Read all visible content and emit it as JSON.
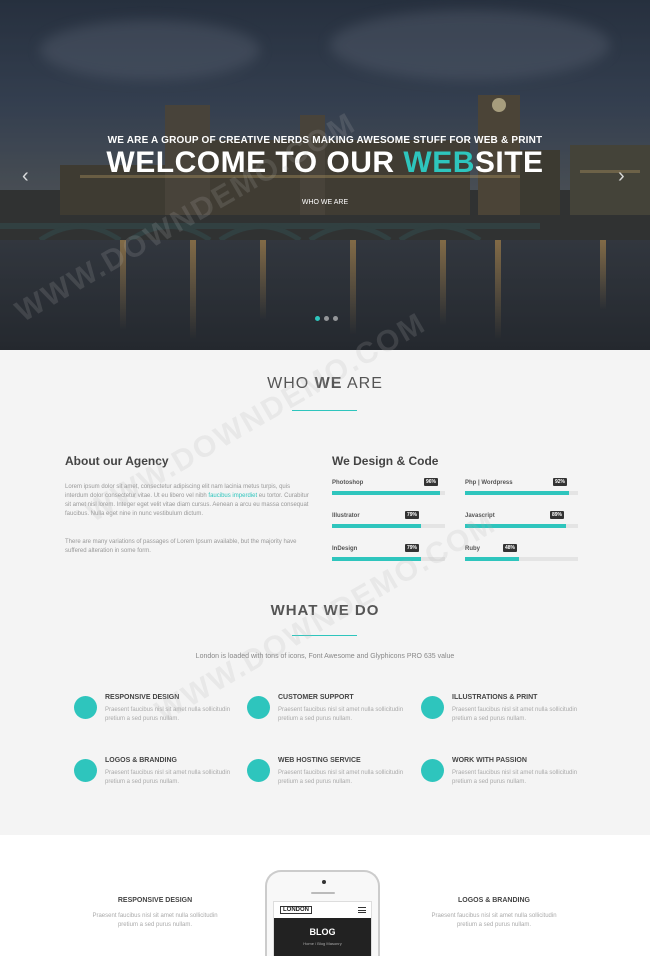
{
  "hero": {
    "tagline": "WE ARE A GROUP OF CREATIVE NERDS MAKING AWESOME STUFF FOR WEB & PRINT",
    "title_part1": "WELCOME TO OUR ",
    "title_accent": "WEB",
    "title_part2": "SITE",
    "link": "WHO WE ARE",
    "prev_arrow": "‹",
    "next_arrow": "›"
  },
  "who": {
    "title_light": "WHO ",
    "title_bold": "WE",
    "title_light2": " ARE",
    "about_title": "About our Agency",
    "about_p1_a": "Lorem ipsum dolor sit amet, consectetur adipiscing elit nam lacinia metus turpis, quis interdum dolor consectetur vitae. Ut eu libero vel nibh ",
    "about_p1_link": "faucibus imperdiet",
    "about_p1_b": " eu tortor. Curabitur sit amet nisl lorem. Integer eget velit vitae diam cursus. Aenean a arcu eu massa consequat faucibus. Nulla eget nine in nunc vestibulum dictum.",
    "about_p2": "There are many variations of passages of Lorem Ipsum available, but the majority have suffered alteration in some form.",
    "design_title": "We Design & Code",
    "skills": [
      {
        "name": "Photoshop",
        "percent": 96,
        "label": "96%"
      },
      {
        "name": "Php | Wordpress",
        "percent": 92,
        "label": "92%"
      },
      {
        "name": "Illustrator",
        "percent": 79,
        "label": "79%"
      },
      {
        "name": "Javascript",
        "percent": 89,
        "label": "89%"
      },
      {
        "name": "InDesign",
        "percent": 79,
        "label": "79%"
      },
      {
        "name": "Ruby",
        "percent": 48,
        "label": "48%"
      }
    ]
  },
  "whatwedo": {
    "title": "WHAT WE DO",
    "subtitle": "London is loaded with tons of icons, Font Awesome and Glyphicons PRO 635 value",
    "services": [
      {
        "title": "RESPONSIVE DESIGN",
        "text": "Praesent faucibus nisl sit amet nulla sollicitudin pretium a sed purus nullam."
      },
      {
        "title": "CUSTOMER SUPPORT",
        "text": "Praesent faucibus nisl sit amet nulla sollicitudin pretium a sed purus nullam."
      },
      {
        "title": "ILLUSTRATIONS & PRINT",
        "text": "Praesent faucibus nisl sit amet nulla sollicitudin pretium a sed purus nullam."
      },
      {
        "title": "LOGOS & BRANDING",
        "text": "Praesent faucibus nisl sit amet nulla sollicitudin pretium a sed purus nullam."
      },
      {
        "title": "WEB HOSTING SERVICE",
        "text": "Praesent faucibus nisl sit amet nulla sollicitudin pretium a sed purus nullam."
      },
      {
        "title": "WORK WITH PASSION",
        "text": "Praesent faucibus nisl sit amet nulla sollicitudin pretium a sed purus nullam."
      }
    ]
  },
  "features": {
    "left_title": "RESPONSIVE DESIGN",
    "left_text": "Praesent faucibus nisl sit amet nulla sollicitudin pretium a sed purus nullam.",
    "right_title": "LOGOS & BRANDING",
    "right_text": "Praesent faucibus nisl sit amet nulla sollicitudin pretium a sed purus nullam.",
    "phone_logo": "LONDON",
    "phone_banner": "BLOG",
    "phone_crumb": "Home  /  Blog Masonry"
  },
  "watermark": "WWW.DOWNDEMO.COM",
  "colors": {
    "accent": "#2ec5bd",
    "dark": "#444444",
    "muted": "#aaaaaa"
  }
}
